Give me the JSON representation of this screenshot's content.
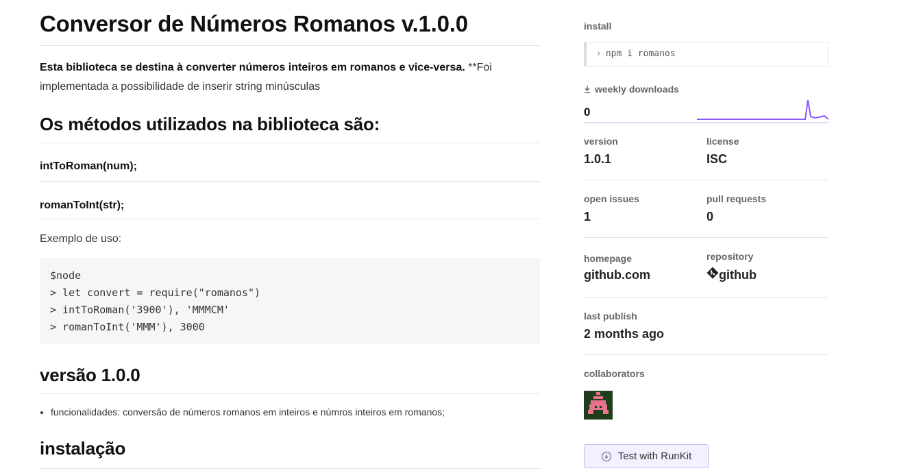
{
  "readme": {
    "title": "Conversor de Números Romanos v.1.0.0",
    "intro_bold": "Esta biblioteca se destina à converter números inteiros em romanos e vice-versa.",
    "intro_rest": " **Foi implementada a possibilidade de inserir string minúsculas",
    "methods_heading": "Os métodos utilizados na biblioteca são:",
    "methods": [
      "intToRoman(num);",
      "romanToInt(str);"
    ],
    "usage_label": "Exemplo de uso:",
    "code_lines": [
      "$node",
      "> let convert = require(\"romanos\")",
      "> intToRoman('3900'), 'MMMCM'",
      "> romanToInt('MMM'), 3000"
    ],
    "version_heading": "versão 1.0.0",
    "bullets": [
      "funcionalidades: conversão de números romanos em inteiros e númros inteiros em romanos;"
    ],
    "install_heading": "instalação"
  },
  "sidebar": {
    "install_label": "install",
    "install_command": "npm i romanos",
    "weekly_downloads_label": "weekly downloads",
    "weekly_downloads_value": "0",
    "version_label": "version",
    "version_value": "1.0.1",
    "license_label": "license",
    "license_value": "ISC",
    "open_issues_label": "open issues",
    "open_issues_value": "1",
    "pull_requests_label": "pull requests",
    "pull_requests_value": "0",
    "homepage_label": "homepage",
    "homepage_value": "github.com",
    "repository_label": "repository",
    "repository_value": "github",
    "last_publish_label": "last publish",
    "last_publish_value": "2 months ago",
    "collaborators_label": "collaborators",
    "runkit_label": "Test with RunKit"
  },
  "colors": {
    "sparkline": "#8956ff",
    "runkit_border": "#c9b8f0",
    "avatar_bg": "#1f3d1c",
    "avatar_fg": "#e8718d"
  }
}
